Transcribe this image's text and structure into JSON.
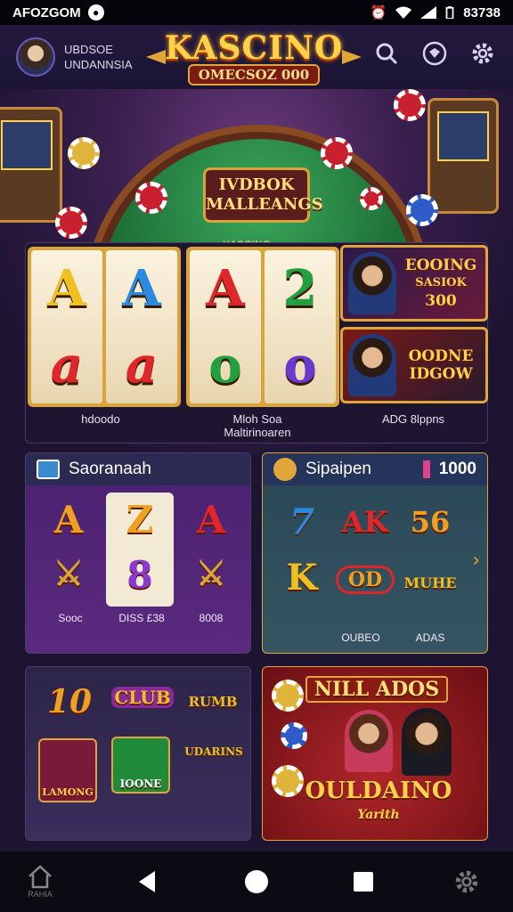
{
  "status_bar": {
    "left_text": "AFOZGOM",
    "time": "83738"
  },
  "header": {
    "user_line1": "UBDSOE",
    "user_line2": "UNDANNSIA",
    "logo_title": "KASCINO",
    "logo_subtitle": "OMECSOZ 000",
    "icons": [
      "search-icon",
      "badge-icon",
      "gear-icon"
    ]
  },
  "hero": {
    "table_sign_line1": "IVDBOK",
    "table_sign_line2": "MALLEANGS",
    "table_rim_label": "KASCINO"
  },
  "reels": {
    "group1": [
      {
        "top": "A",
        "bottom": "a"
      },
      {
        "top": "A",
        "bottom": "a"
      }
    ],
    "group2": [
      {
        "top": "A",
        "bottom": "o"
      },
      {
        "top": "2",
        "bottom": "o"
      }
    ],
    "promos": [
      {
        "line1": "EOOING",
        "line2": "SASIOK",
        "line3": "300"
      },
      {
        "line1": "OODNE",
        "line2": "IDGOW"
      }
    ],
    "captions": [
      "hdoodo",
      "Mloh Soa",
      "Maltirinoaren",
      "ADG 8lppns"
    ]
  },
  "card_left_top": {
    "title": "Saoranaah",
    "tiles_row1": [
      "A",
      "Z",
      "A"
    ],
    "tiles_row2": [
      "⚔",
      "8",
      "⚔"
    ],
    "labels": [
      "Sooc",
      "DISS £38",
      "8008"
    ]
  },
  "card_right_top": {
    "title": "Sipaipen",
    "amount": "1000",
    "tiles_row1": [
      "7",
      "AK",
      "56"
    ],
    "tiles_row2": [
      "K",
      "OD",
      "MUHE"
    ],
    "labels": [
      "OUBEO",
      "ADAS"
    ]
  },
  "card_left_bottom": {
    "tiles_row1": [
      "10",
      "CLUB",
      "RUMB"
    ],
    "tiles_row2": [
      "LAMONG",
      "IOONE",
      "UDARINS"
    ]
  },
  "card_right_bottom": {
    "banner": "NILL ADOS",
    "title": "OULDAINO",
    "subtitle": "Yarith"
  },
  "bottom_nav": {
    "home_label": "RAHIA"
  },
  "colors": {
    "accent_gold": "#ffd24a",
    "panel_purple": "#5a2a7e",
    "panel_teal": "#2f4f5a",
    "banner_red": "#8a1a1a"
  }
}
